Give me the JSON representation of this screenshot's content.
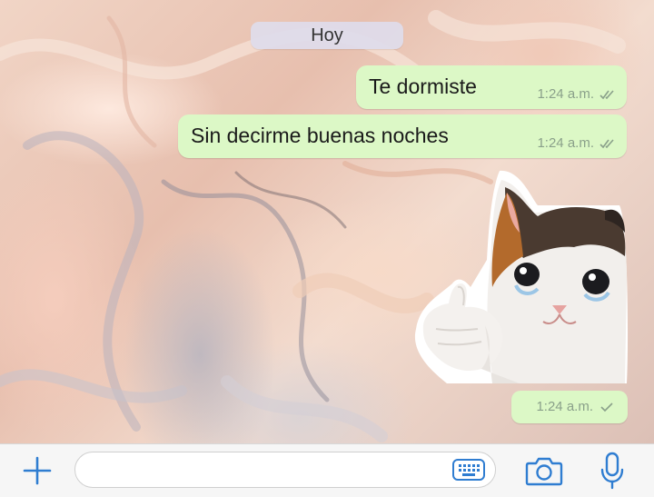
{
  "chat": {
    "date_label": "Hoy",
    "messages": [
      {
        "text": "Te dormiste",
        "time": "1:24 a.m."
      },
      {
        "text": "Sin decirme buenas noches",
        "time": "1:24 a.m."
      }
    ],
    "sticker": {
      "description_icon": "crying-cat-thumbs-up-sticker",
      "time": "1:24 a.m."
    }
  },
  "input_bar": {
    "placeholder": "",
    "icons": [
      "plus-icon",
      "keyboard-icon",
      "camera-icon",
      "microphone-icon"
    ]
  },
  "colors": {
    "outgoing_bubble": "#dcf8c6",
    "accent_blue": "#2f7dd1",
    "meta_text": "#8aa08a"
  }
}
